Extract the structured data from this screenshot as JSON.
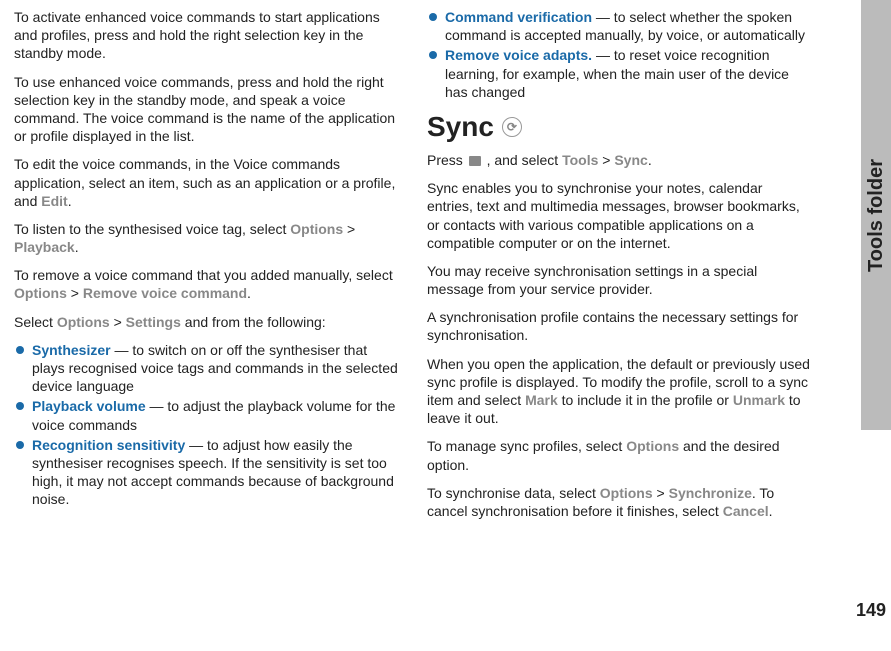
{
  "sidebar": {
    "label": "Tools folder"
  },
  "page_number": "149",
  "left": {
    "p1": "To activate enhanced voice commands to start applications and profiles, press and hold the right selection key in the standby mode.",
    "p2": "To use enhanced voice commands, press and hold the right selection key in the standby mode, and speak a voice command. The voice command is the name of the application or profile displayed in the list.",
    "p3_a": "To edit the voice commands, in the Voice commands application, select an item, such as an application or a profile, and ",
    "p3_edit": "Edit",
    "p3_b": ".",
    "p4_a": "To listen to the synthesised voice tag, select ",
    "p4_opt": "Options",
    "p4_gt": " > ",
    "p4_play": "Playback",
    "p4_b": ".",
    "p5_a": "To remove a voice command that you added manually, select ",
    "p5_opt": "Options",
    "p5_gt": " > ",
    "p5_rem": "Remove voice command",
    "p5_b": ".",
    "p6_a": "Select ",
    "p6_opt": "Options",
    "p6_gt": " > ",
    "p6_set": "Settings",
    "p6_b": " and from the following:",
    "b1_k": "Synthesizer",
    "b1_v": " — to switch on or off the synthesiser that plays recognised voice tags and commands in the selected device language",
    "b2_k": "Playback volume",
    "b2_v": " — to adjust the playback volume for the voice commands",
    "b3_k": "Recognition sensitivity",
    "b3_v": " — to adjust how easily the synthesiser recognises speech. If the sensitivity is set too high, it may not accept commands because of background noise."
  },
  "right": {
    "b4_k": "Command verification",
    "b4_v": " — to select whether the spoken command is accepted manually, by voice, or automatically",
    "b5_k": "Remove voice adapts.",
    "b5_v": " — to reset voice recognition learning, for example, when the main user of the device has changed",
    "h2": "Sync",
    "p1_a": "Press ",
    "p1_b": " , and select ",
    "p1_tools": "Tools",
    "p1_gt": " > ",
    "p1_sync": "Sync",
    "p1_c": ".",
    "p2": "Sync enables you to synchronise your notes, calendar entries, text and multimedia messages, browser bookmarks, or contacts with various compatible applications on a compatible computer or on the internet.",
    "p3": "You may receive synchronisation settings in a special message from your service provider.",
    "p4": "A synchronisation profile contains the necessary settings for synchronisation.",
    "p5_a": "When you open the application, the default or previously used sync profile is displayed. To modify the profile, scroll to a sync item and select ",
    "p5_mark": "Mark",
    "p5_b": " to include it in the profile or ",
    "p5_unmark": "Unmark",
    "p5_c": " to leave it out.",
    "p6_a": "To manage sync profiles, select ",
    "p6_opt": "Options",
    "p6_b": " and the desired option.",
    "p7_a": "To synchronise data, select ",
    "p7_opt": "Options",
    "p7_gt": " > ",
    "p7_sync": "Synchronize",
    "p7_b": ". To cancel synchronisation before it finishes, select ",
    "p7_cancel": "Cancel",
    "p7_c": "."
  }
}
